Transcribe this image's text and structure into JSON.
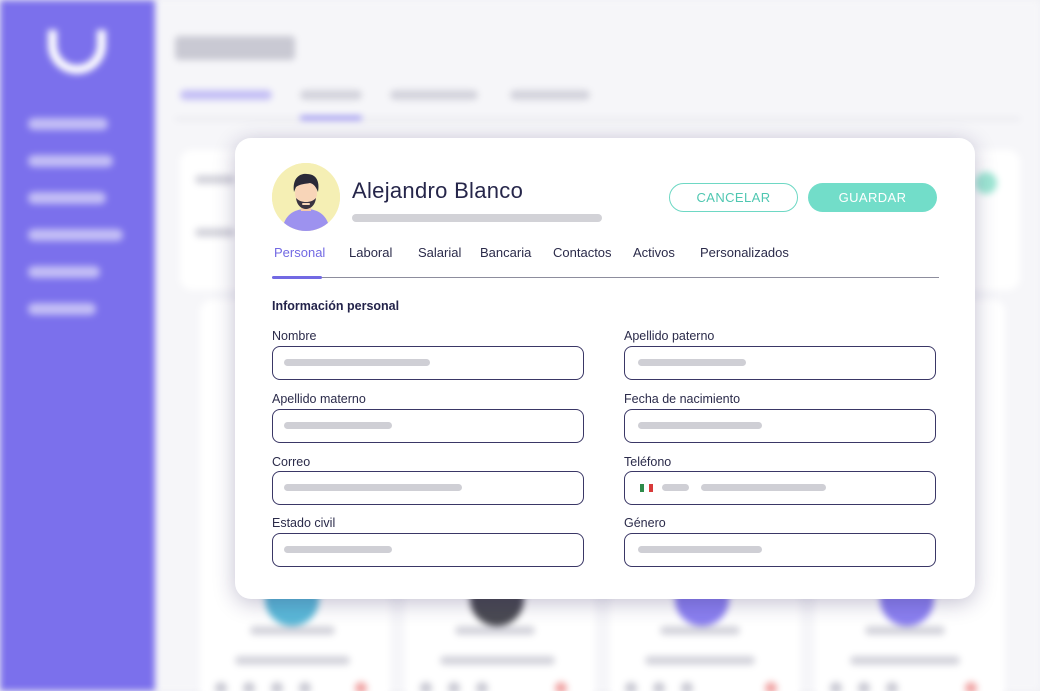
{
  "employee": {
    "name": "Alejandro Blanco"
  },
  "actions": {
    "cancel_label": "CANCELAR",
    "save_label": "GUARDAR"
  },
  "tabs": [
    {
      "label": "Personal",
      "active": true
    },
    {
      "label": "Laboral",
      "active": false
    },
    {
      "label": "Salarial",
      "active": false
    },
    {
      "label": "Bancaria",
      "active": false
    },
    {
      "label": "Contactos",
      "active": false
    },
    {
      "label": "Activos",
      "active": false
    },
    {
      "label": "Personalizados",
      "active": false
    }
  ],
  "form": {
    "section_title": "Información personal",
    "fields": [
      {
        "label": "Nombre"
      },
      {
        "label": "Apellido paterno"
      },
      {
        "label": "Apellido materno"
      },
      {
        "label": "Fecha de nacimiento"
      },
      {
        "label": "Correo"
      },
      {
        "label": "Teléfono",
        "country_flag": "mexico-flag-icon"
      },
      {
        "label": "Estado civil"
      },
      {
        "label": "Género"
      }
    ]
  },
  "colors": {
    "accent": "#7269e3",
    "sidebar": "#7b70ec",
    "success": "#72ddc9",
    "field_border": "#3a3766"
  }
}
